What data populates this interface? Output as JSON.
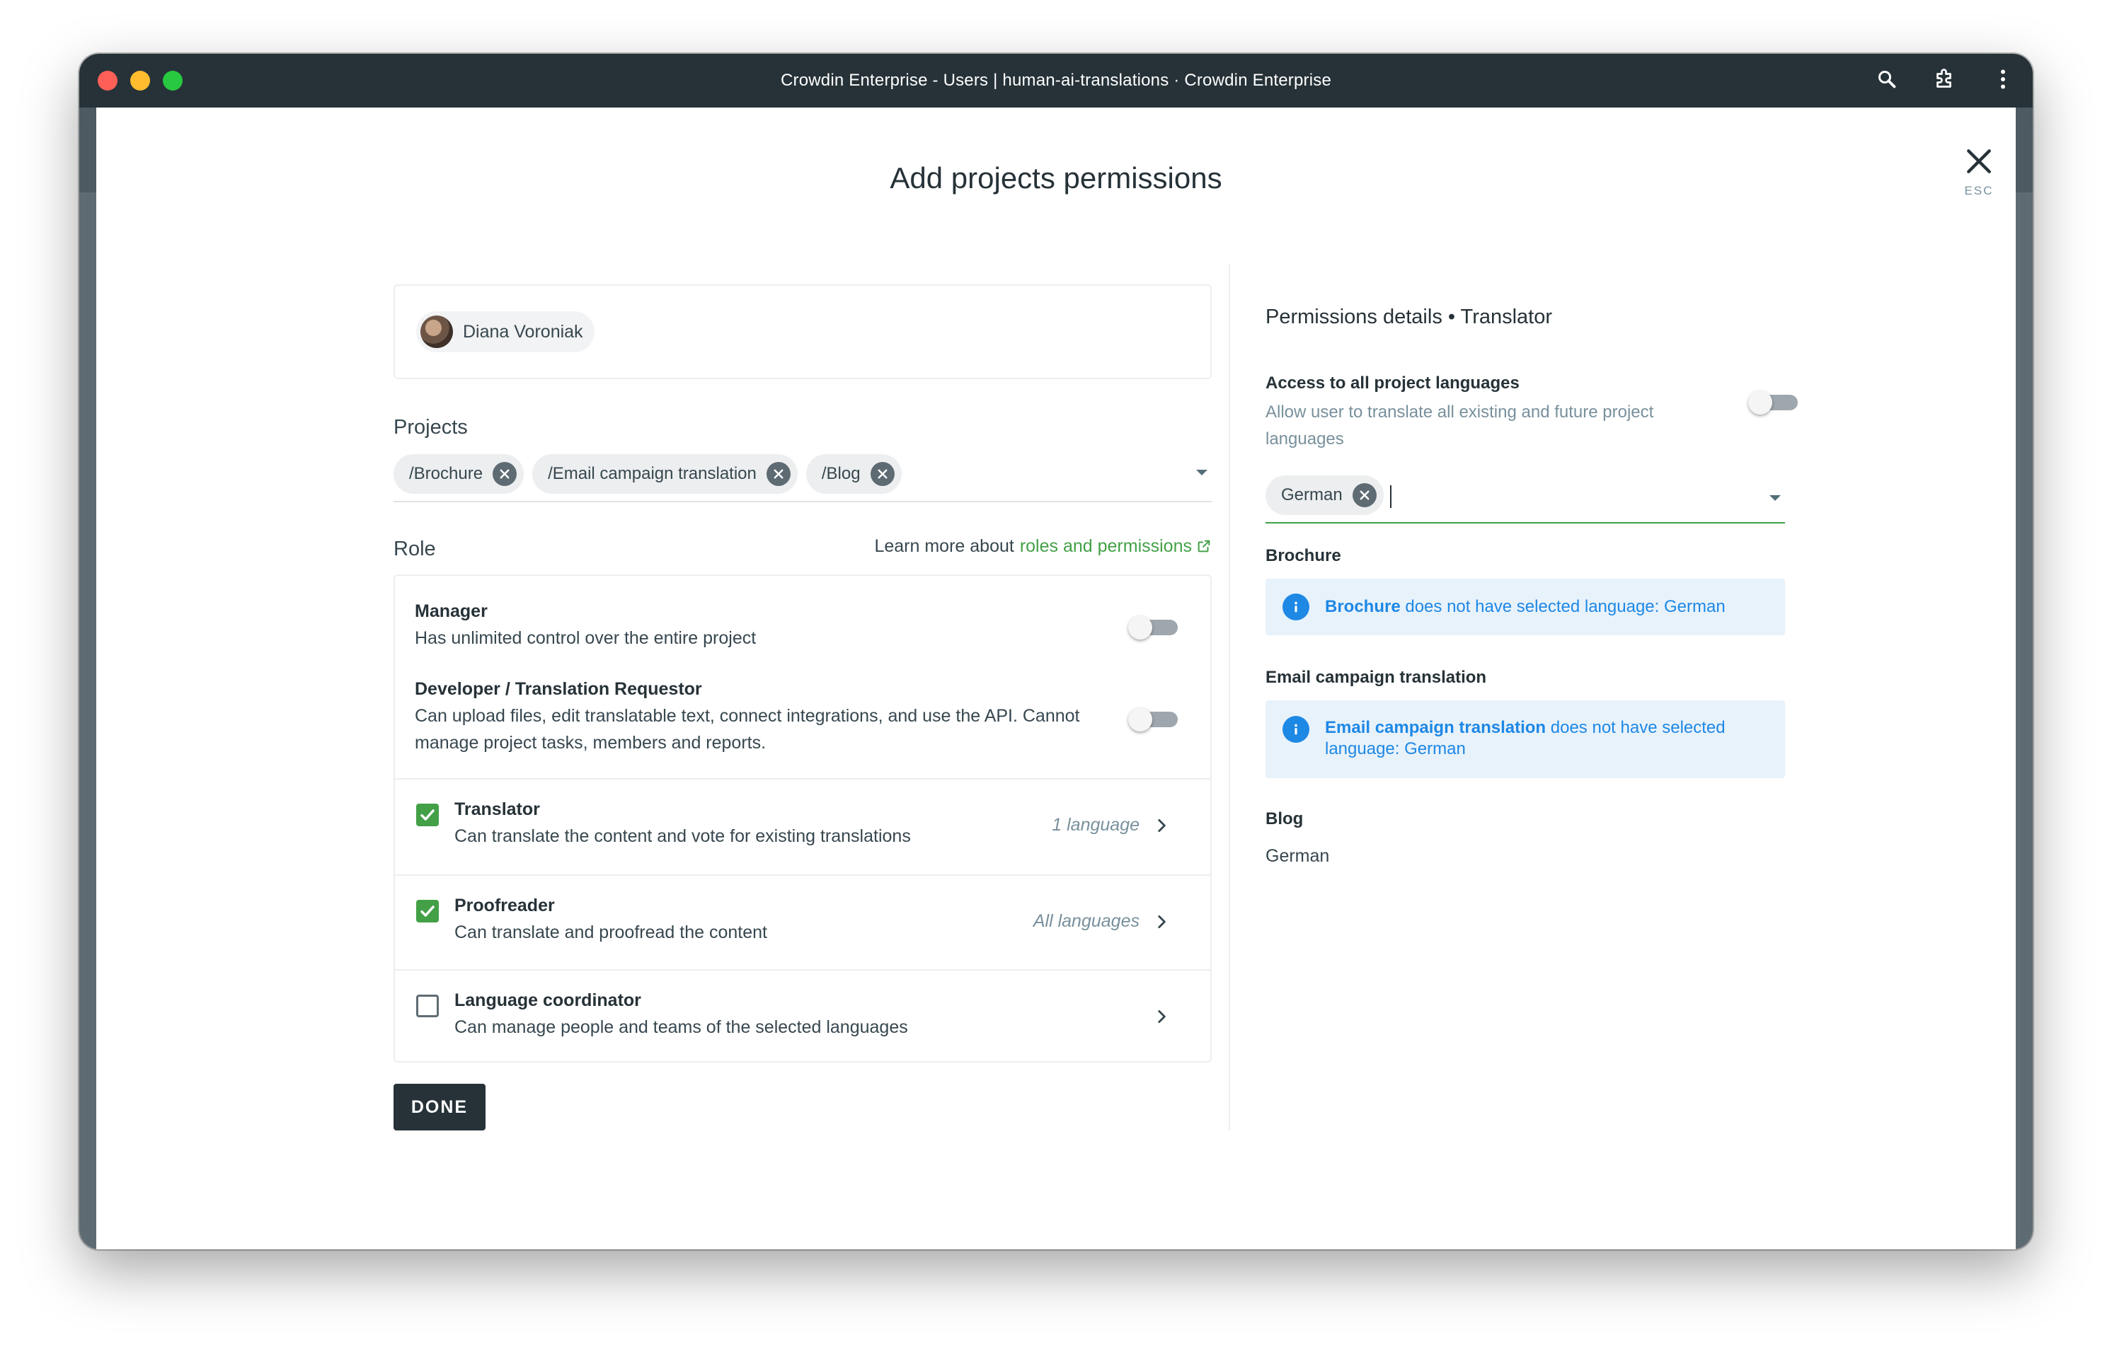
{
  "window": {
    "title": "Crowdin Enterprise - Users | human-ai-translations · Crowdin Enterprise"
  },
  "dialog": {
    "title": "Add projects permissions",
    "close_hint": "ESC"
  },
  "user": {
    "name": "Diana Voroniak"
  },
  "projects": {
    "label": "Projects",
    "selected": [
      "/Brochure",
      "/Email campaign translation",
      "/Blog"
    ]
  },
  "role": {
    "label": "Role",
    "learn_more_prefix": "Learn more about",
    "learn_more_link": "roles and permissions",
    "manager": {
      "title": "Manager",
      "desc": "Has unlimited control over the entire project"
    },
    "developer": {
      "title": "Developer / Translation Requestor",
      "desc": "Can upload files, edit translatable text, connect integrations, and use the API. Cannot manage project tasks, members and reports."
    },
    "translator": {
      "title": "Translator",
      "desc": "Can translate the content and vote for existing translations",
      "meta": "1 language",
      "checked": true
    },
    "proofreader": {
      "title": "Proofreader",
      "desc": "Can translate and proofread the content",
      "meta": "All languages",
      "checked": true
    },
    "coordinator": {
      "title": "Language coordinator",
      "desc": "Can manage people and teams of the selected languages",
      "checked": false
    }
  },
  "done_label": "DONE",
  "details": {
    "title": "Permissions details • Translator",
    "access_title": "Access to all project languages",
    "access_desc": "Allow user to translate all existing and future project languages",
    "selected_language": "German",
    "brochure": {
      "title": "Brochure",
      "info_bold": "Brochure",
      "info_rest": " does not have selected language: German"
    },
    "email": {
      "title": "Email campaign translation",
      "info_bold": "Email campaign translation",
      "info_rest": " does not have selected language: German"
    },
    "blog": {
      "title": "Blog",
      "language": "German"
    }
  },
  "colors": {
    "accent_green": "#43a047",
    "dark": "#263238",
    "info_blue": "#1e88e5",
    "info_bg": "#e8f2fb"
  }
}
